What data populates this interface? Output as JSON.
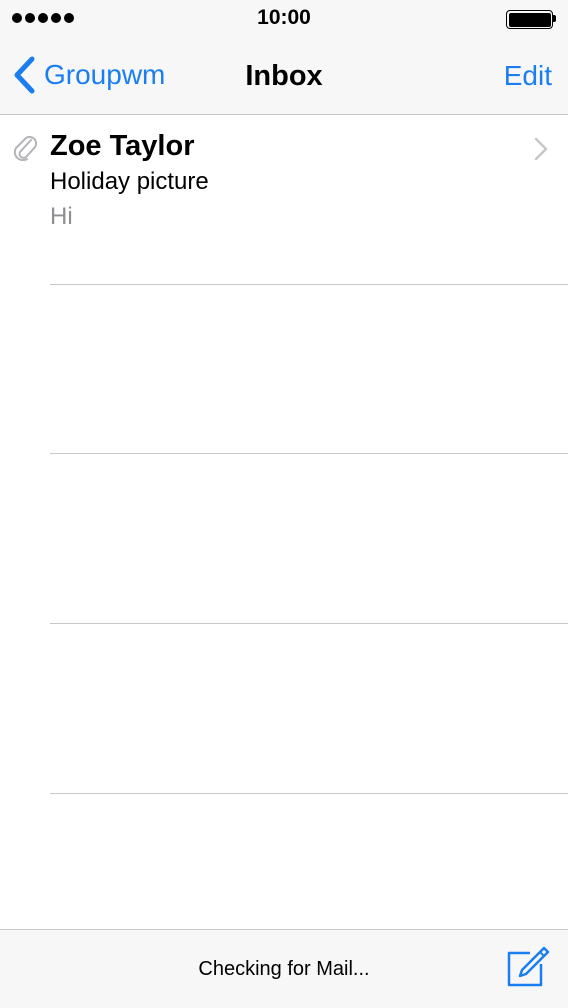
{
  "status_bar": {
    "time": "10:00",
    "signal_bars": 5
  },
  "nav": {
    "back_label": "Groupwm",
    "title": "Inbox",
    "edit_label": "Edit"
  },
  "mail": [
    {
      "sender": "Zoe Taylor",
      "subject": "Holiday picture",
      "preview": "Hi",
      "has_attachment": true
    }
  ],
  "toolbar": {
    "status_text": "Checking for Mail..."
  },
  "colors": {
    "accent": "#1b7ef0",
    "secondary_text": "#8e8e93",
    "separator": "#c8c7cc",
    "bar_background": "#f7f7f7"
  },
  "icons": {
    "back": "chevron-left-icon",
    "attachment": "paperclip-icon",
    "disclosure": "chevron-right-icon",
    "compose": "compose-icon",
    "battery": "battery-icon",
    "signal": "signal-icon"
  }
}
